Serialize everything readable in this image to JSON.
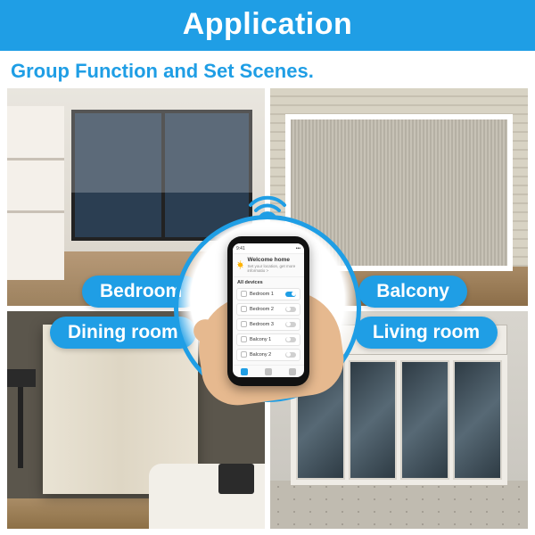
{
  "header": {
    "title": "Application"
  },
  "subtitle": "Group Function and Set Scenes.",
  "rooms": {
    "bedroom": "Bedroom",
    "balcony": "Balcony",
    "dining": "Dining room",
    "living": "Living room"
  },
  "phone": {
    "status_time": "9:41",
    "welcome_title": "Welcome home",
    "welcome_sub": "Set your location, get more informatio >",
    "section": "All devices",
    "devices": [
      {
        "name": "Bedroom 1",
        "on": true
      },
      {
        "name": "Bedroom 2",
        "on": false
      },
      {
        "name": "Bedroom 3",
        "on": false
      },
      {
        "name": "Balcony 1",
        "on": false
      },
      {
        "name": "Balcony 2",
        "on": false
      }
    ],
    "tabs": [
      "home",
      "smart",
      "me"
    ]
  },
  "icons": {
    "wifi": "wifi-icon",
    "sun": "sun-icon"
  },
  "colors": {
    "accent": "#1f9ee5"
  }
}
